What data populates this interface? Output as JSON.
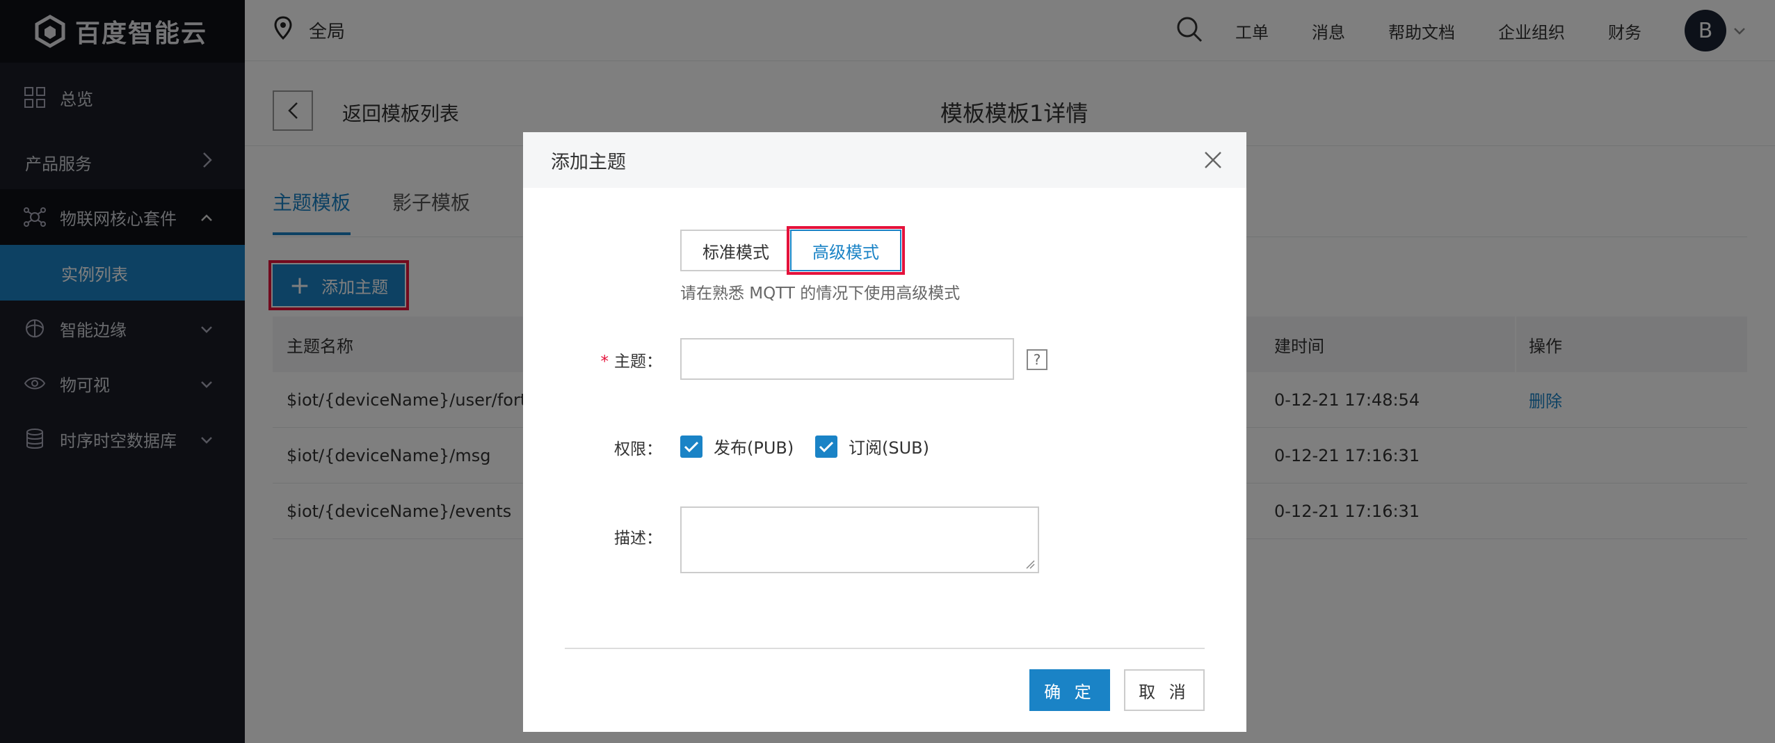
{
  "brand": {
    "name": "百度智能云"
  },
  "sidebar": {
    "items": [
      {
        "label": "总览"
      },
      {
        "label": "产品服务"
      },
      {
        "label": "物联网核心套件"
      },
      {
        "label": "实例列表"
      },
      {
        "label": "智能边缘"
      },
      {
        "label": "物可视"
      },
      {
        "label": "时序时空数据库"
      }
    ]
  },
  "topbar": {
    "region": "全局",
    "links": [
      "工单",
      "消息",
      "帮助文档",
      "企业组织",
      "财务"
    ],
    "avatar": "B"
  },
  "page": {
    "back_label": "返回模板列表",
    "title": "模板模板1详情",
    "tabs": [
      "主题模板",
      "影子模板"
    ],
    "add_button": "添加主题"
  },
  "table": {
    "headers": {
      "name": "主题名称",
      "time": "建时间",
      "op": "操作"
    },
    "rows": [
      {
        "name": "$iot/{deviceName}/user/fortes",
        "time": "0-12-21 17:48:54",
        "op": "删除"
      },
      {
        "name": "$iot/{deviceName}/msg",
        "time": "0-12-21 17:16:31",
        "op": ""
      },
      {
        "name": "$iot/{deviceName}/events",
        "time": "0-12-21 17:16:31",
        "op": ""
      }
    ]
  },
  "modal": {
    "title": "添加主题",
    "modes": [
      "标准模式",
      "高级模式"
    ],
    "hint": "请在熟悉 MQTT 的情况下使用高级模式",
    "topic_label": "主题：",
    "topic_value": "",
    "perm_label": "权限：",
    "perm_pub": "发布(PUB)",
    "perm_sub": "订阅(SUB)",
    "desc_label": "描述：",
    "desc_value": "",
    "ok": "确 定",
    "cancel": "取 消"
  },
  "colors": {
    "accent": "#1a83c6",
    "highlight": "#e4123b",
    "sidebar": "#1a1d26"
  }
}
